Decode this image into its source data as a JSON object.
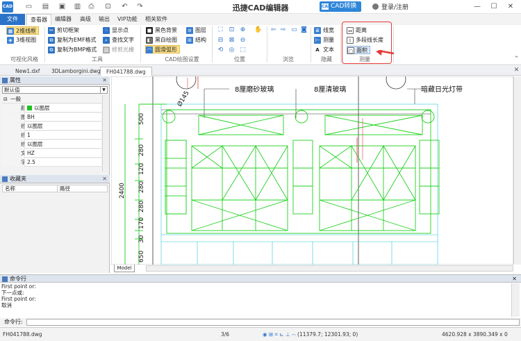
{
  "app": {
    "logo_text": "CAD",
    "title": "迅捷CAD编辑器",
    "converter_label": "CAD转换器",
    "login_label": "登录/注册"
  },
  "menu_tabs": [
    "文件",
    "查看器",
    "编辑器",
    "高级",
    "输出",
    "VIP功能",
    "相关软件"
  ],
  "ribbon": {
    "visual_style": {
      "items": [
        "2维线框",
        "3维视图"
      ],
      "label": "可视化风格"
    },
    "tools": {
      "col1": [
        "剪切框架",
        "复制为EMF格式",
        "复制为BMP格式"
      ],
      "col2": [
        "显示点",
        "查找文字",
        "修剪光栅"
      ],
      "label": "工具"
    },
    "cad_settings": {
      "col1": [
        "黑色背景",
        "黑白绘图",
        "圆滑弧形"
      ],
      "col2": [
        "图层",
        "结构"
      ],
      "label": "CAD绘图设置"
    },
    "position": {
      "label": "位置"
    },
    "browse": {
      "label": "浏览"
    },
    "hide": {
      "items": [
        "线宽",
        "测量",
        "文本"
      ],
      "label": "隐藏"
    },
    "measure": {
      "items": [
        "距离",
        "多段线长度",
        "面积"
      ],
      "label": "测量"
    }
  },
  "doc_tabs": [
    "New1.dxf",
    "3DLamborgini.dwg",
    "FH041788.dwg"
  ],
  "properties": {
    "header": "属性",
    "combo_value": "默认值",
    "group": "一般",
    "rows": [
      {
        "key": "颜",
        "value": "以图层",
        "swatch": true
      },
      {
        "key": "图",
        "value": "BH"
      },
      {
        "key": "线",
        "value": "以图层"
      },
      {
        "key": "线",
        "value": "1"
      },
      {
        "key": "线",
        "value": "以图层"
      },
      {
        "key": "文",
        "value": "HZ"
      },
      {
        "key": "字",
        "value": "2.5"
      }
    ]
  },
  "favorites": {
    "header": "收藏夹",
    "col_name": "名称",
    "col_path": "路径"
  },
  "drawing": {
    "labels": [
      "8厘磨砂玻璃",
      "8厘清玻璃",
      "暗藏日光灯带"
    ],
    "diameter": "Ø145",
    "dims": [
      "500",
      "280",
      "120",
      "280",
      "280",
      "170",
      "30",
      "650"
    ],
    "total": "2400"
  },
  "model_tab": "Model",
  "command": {
    "header": "命令行",
    "log": [
      "First point or:",
      "下一点或:",
      "First point or:",
      "取消"
    ],
    "input_label": "命令行:"
  },
  "status": {
    "file": "FH041788.dwg",
    "page": "3/6",
    "coords": "(11379.7; 12301.93; 0)",
    "extents": "4620.928 x 3890.349 x 0"
  },
  "colors": {
    "accent": "#2b72c9",
    "cad_green": "#1fd11f",
    "highlight_box": "#e53935"
  }
}
